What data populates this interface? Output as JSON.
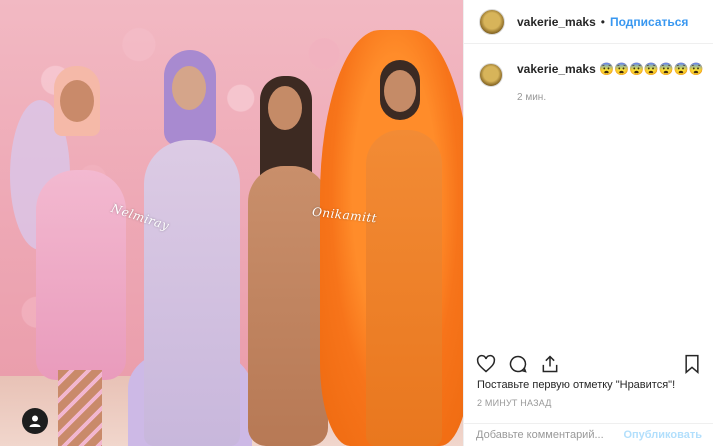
{
  "post": {
    "username": "vakerie_maks",
    "follow_label": "Подписаться",
    "caption_emoji": "😨😨😨😨😨😨😨",
    "caption_time": "2 мин.",
    "likes_text": "Поставьте первую отметку \"Нравится\"!",
    "post_time": "2 МИНУТ НАЗАД",
    "comment_placeholder": "Добавьте комментарий...",
    "publish_label": "Опубликовать"
  },
  "photo": {
    "watermark_left": "Nelmiray",
    "watermark_right": "Onikamitt"
  },
  "icons": {
    "like": "heart-icon",
    "comment": "comment-icon",
    "share": "share-icon",
    "save": "bookmark-icon",
    "user": "user-icon"
  },
  "colors": {
    "accent": "#3897f0",
    "publish_disabled": "#b2dffc",
    "muted": "#999999"
  }
}
